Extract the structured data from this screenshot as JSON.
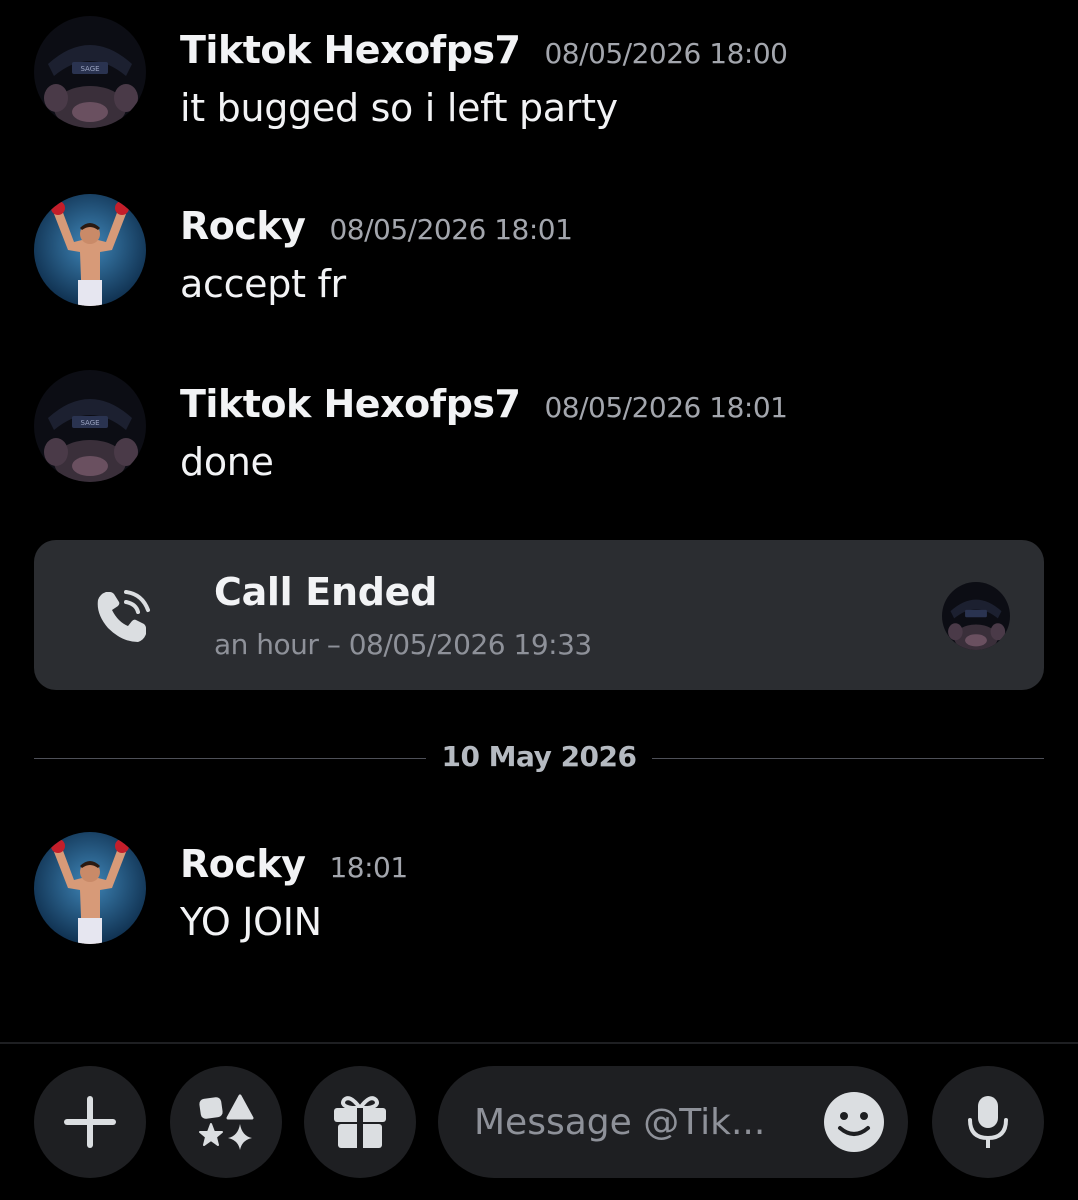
{
  "messages": [
    {
      "username": "Tiktok Hexofps7",
      "timestamp": "08/05/2026 18:00",
      "text": "it bugged so i left party",
      "avatar": "hexo-avatar"
    },
    {
      "username": "Rocky",
      "timestamp": "08/05/2026 18:01",
      "text": "accept fr",
      "avatar": "rocky-avatar"
    },
    {
      "username": "Tiktok Hexofps7",
      "timestamp": "08/05/2026 18:01",
      "text": "done",
      "avatar": "hexo-avatar"
    },
    {
      "username": "Rocky",
      "timestamp": "18:01",
      "text": "YO  JOIN",
      "avatar": "rocky-avatar"
    }
  ],
  "call": {
    "title": "Call Ended",
    "subtitle": "an hour – 08/05/2026 19:33",
    "icon": "phone-icon"
  },
  "divider": {
    "label": "10 May 2026"
  },
  "composer": {
    "placeholder": "Message @Tik...",
    "buttons": [
      "plus-icon",
      "apps-icon",
      "gift-icon",
      "emoji-icon",
      "microphone-icon"
    ]
  },
  "colors": {
    "background": "#000000",
    "card": "#2b2d31",
    "input": "#1e1f22",
    "text": "#f2f3f5",
    "muted": "#a3a6ad"
  }
}
